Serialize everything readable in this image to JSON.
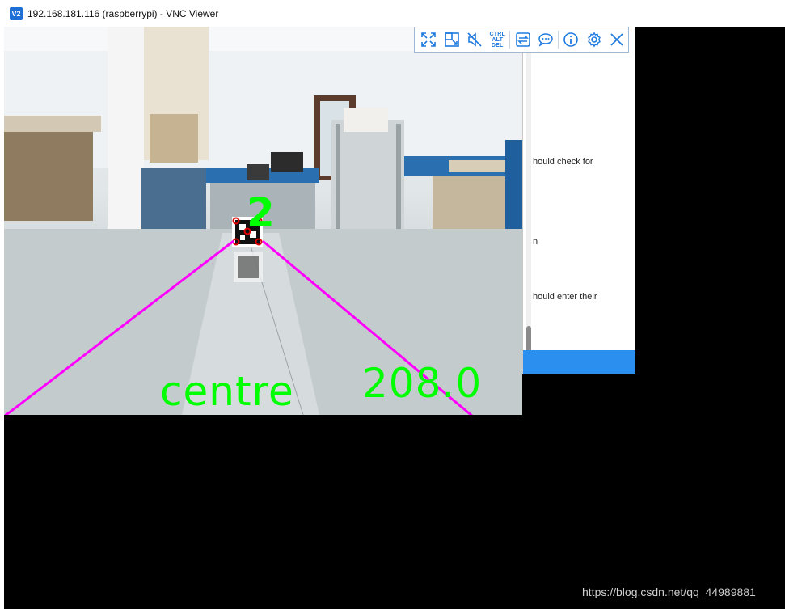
{
  "window": {
    "app_icon_label": "V2",
    "title": "192.168.181.116 (raspberrypi) - VNC Viewer"
  },
  "toolbar": {
    "buttons": [
      {
        "name": "fullscreen",
        "icon": "expand-arrows-icon"
      },
      {
        "name": "scale",
        "icon": "scale-window-icon"
      },
      {
        "name": "audio",
        "icon": "speaker-muted-icon"
      },
      {
        "name": "ctrl-alt-del",
        "icon": "ctrl-alt-del-icon",
        "lines": [
          "CTRL",
          "ALT",
          "DEL"
        ]
      },
      {
        "name": "transfer-files",
        "icon": "transfer-arrows-icon"
      },
      {
        "name": "chat",
        "icon": "chat-bubble-icon"
      },
      {
        "name": "info",
        "icon": "info-icon"
      },
      {
        "name": "options",
        "icon": "gear-icon"
      },
      {
        "name": "close",
        "icon": "close-icon"
      }
    ],
    "accent_color": "#1f7be0"
  },
  "camera": {
    "marker_id": "2",
    "position_label": "centre",
    "distance_value": "208.0",
    "overlay_color": "#00ff00",
    "guide_line_color": "#ff00ff"
  },
  "background_window": {
    "lines": [
      "hould check for",
      "n",
      "hould enter their"
    ],
    "bar_color": "#2b8ff0"
  },
  "watermark": "https://blog.csdn.net/qq_44989881"
}
